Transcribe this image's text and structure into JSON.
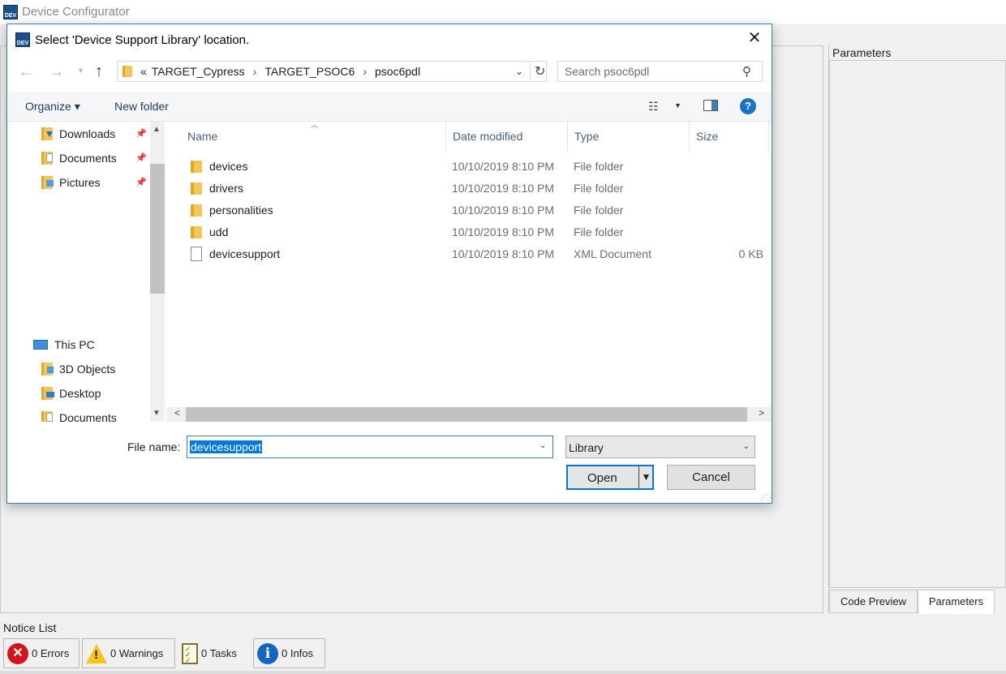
{
  "app": {
    "title": "Device Configurator",
    "icon_text": "DEV",
    "right_panel": {
      "header": "Parameters",
      "tabs": [
        {
          "label": "Code Preview"
        },
        {
          "label": "Parameters"
        }
      ]
    },
    "notice_list": {
      "label": "Notice List",
      "buttons": [
        {
          "label": "0 Errors",
          "icon": "error-icon"
        },
        {
          "label": "0 Warnings",
          "icon": "warning-icon"
        },
        {
          "label": "0 Tasks",
          "icon": "tasks-icon"
        },
        {
          "label": "0 Infos",
          "icon": "info-icon"
        }
      ]
    }
  },
  "dialog": {
    "title": "Select 'Device Support Library' location.",
    "close_glyph": "✕",
    "address": {
      "overflow": "«",
      "crumbs": [
        "TARGET_Cypress",
        "TARGET_PSOC6",
        "psoc6pdl"
      ],
      "separator": "›"
    },
    "search": {
      "placeholder": "Search psoc6pdl"
    },
    "toolbar": {
      "organize_label": "Organize ▾",
      "new_folder_label": "New folder"
    },
    "nav_pane": {
      "quick_access": [
        {
          "label": "Downloads",
          "icon": "downloads-folder-icon"
        },
        {
          "label": "Documents",
          "icon": "documents-folder-icon"
        },
        {
          "label": "Pictures",
          "icon": "pictures-folder-icon"
        }
      ],
      "this_pc": {
        "label": "This PC"
      },
      "pc_items": [
        {
          "label": "3D Objects"
        },
        {
          "label": "Desktop"
        },
        {
          "label": "Documents"
        }
      ]
    },
    "columns": {
      "name": "Name",
      "date": "Date modified",
      "type": "Type",
      "size": "Size"
    },
    "files": [
      {
        "name": "devices",
        "date": "10/10/2019 8:10 PM",
        "type": "File folder",
        "size": "",
        "kind": "folder"
      },
      {
        "name": "drivers",
        "date": "10/10/2019 8:10 PM",
        "type": "File folder",
        "size": "",
        "kind": "folder"
      },
      {
        "name": "personalities",
        "date": "10/10/2019 8:10 PM",
        "type": "File folder",
        "size": "",
        "kind": "folder"
      },
      {
        "name": "udd",
        "date": "10/10/2019 8:10 PM",
        "type": "File folder",
        "size": "",
        "kind": "folder"
      },
      {
        "name": "devicesupport",
        "date": "10/10/2019 8:10 PM",
        "type": "XML Document",
        "size": "0 KB",
        "kind": "file"
      }
    ],
    "file_name": {
      "label": "File name:",
      "value": "devicesupport"
    },
    "filter": {
      "value": "Library"
    },
    "buttons": {
      "open": "Open",
      "cancel": "Cancel"
    }
  },
  "colors": {
    "accent": "#0078d7",
    "dialog_border": "#3c7fb1",
    "selection": "#cce4f7"
  }
}
